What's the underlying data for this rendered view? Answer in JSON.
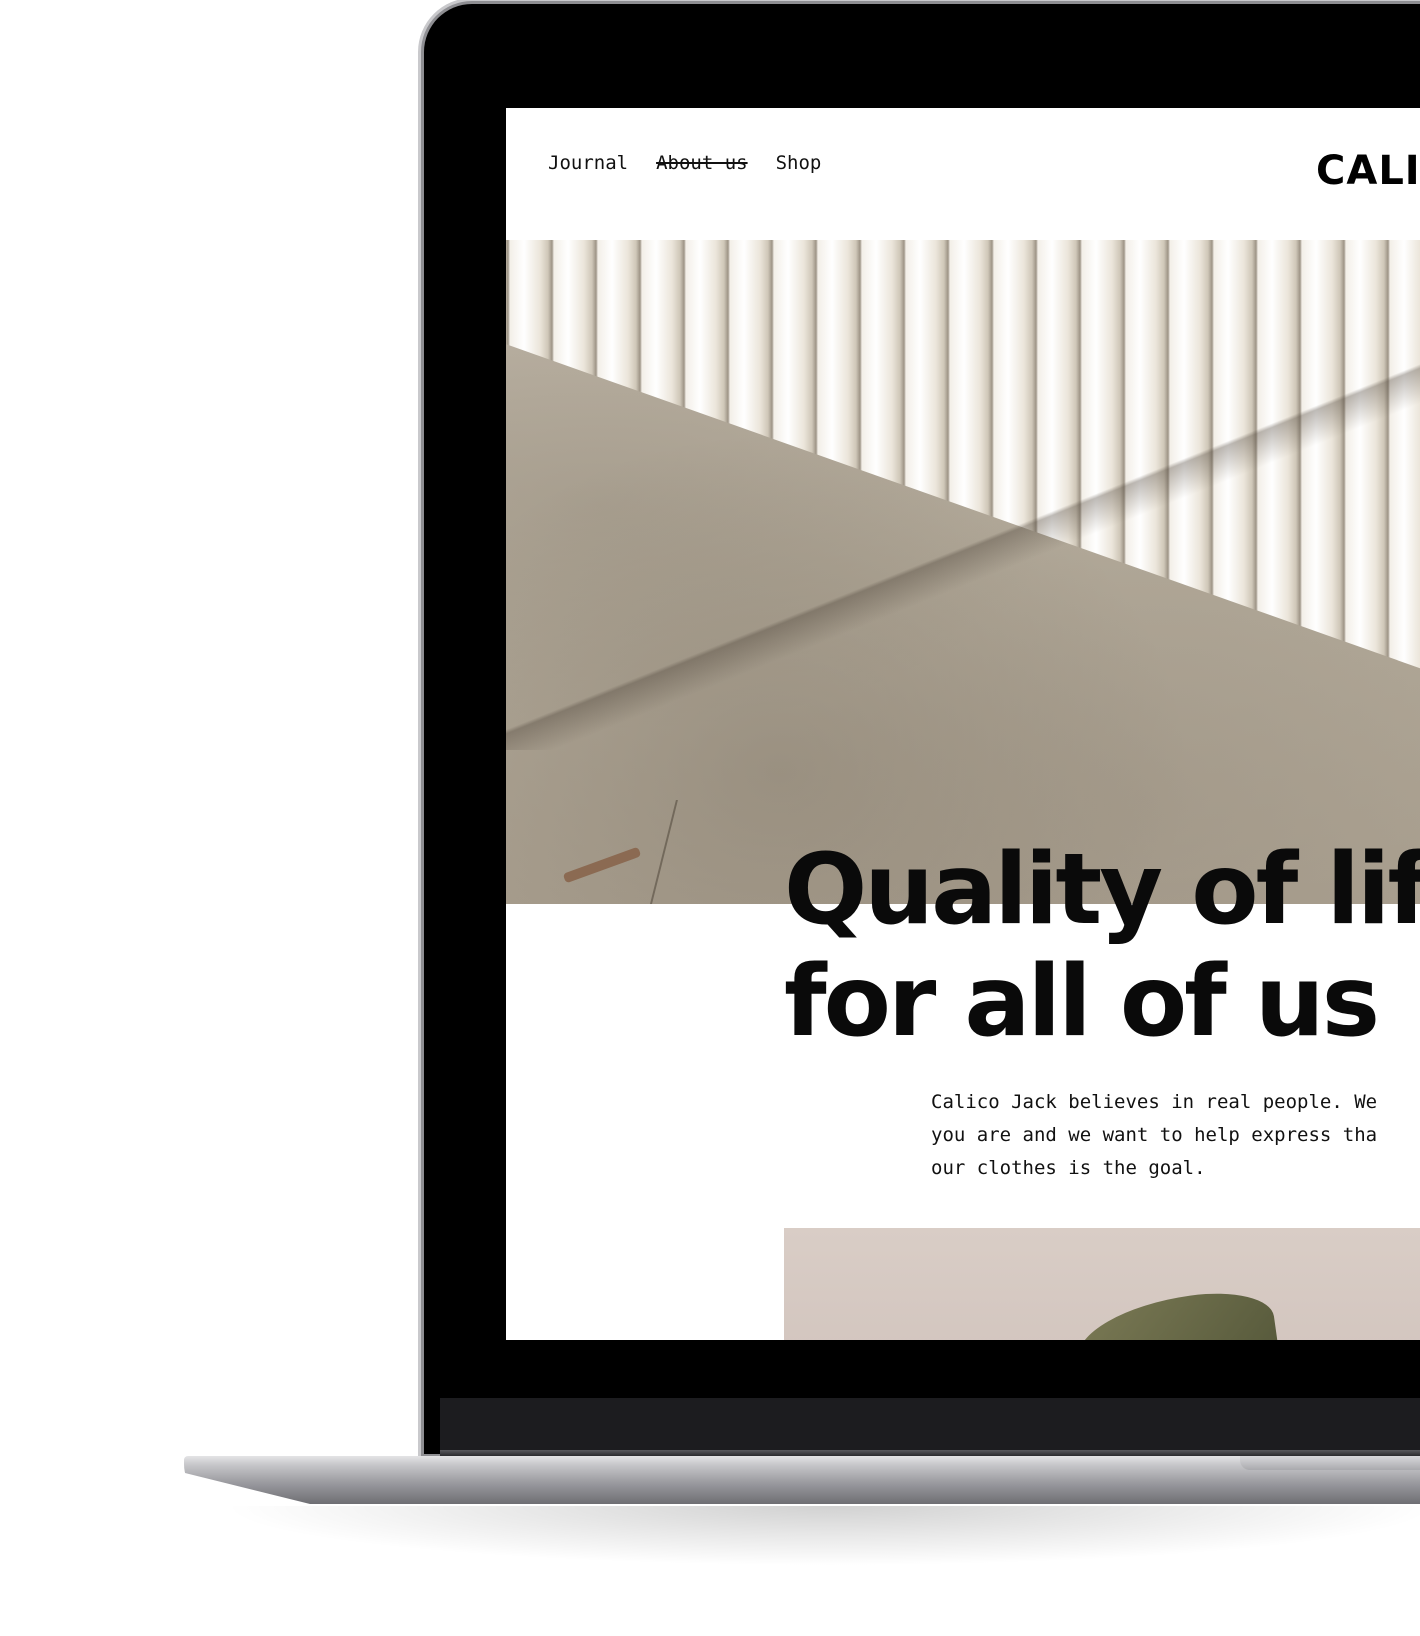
{
  "site": {
    "nav": [
      {
        "label": "Journal",
        "strikethrough": false
      },
      {
        "label": "About us",
        "strikethrough": true
      },
      {
        "label": "Shop",
        "strikethrough": false
      }
    ],
    "logo_text": "CALI"
  },
  "hero": {
    "headline_line1": "Quality of life",
    "headline_line2": "for all of us",
    "intro_lines": [
      "Calico Jack believes in real people. We",
      "you are and we want to help express tha",
      "our clothes is the goal."
    ]
  },
  "colors": {
    "text": "#111111",
    "background": "#ffffff",
    "bezel": "#000000"
  },
  "icons": {
    "hero_image": "white-fluted-columns-on-concrete",
    "second_image": "leaf-on-pink-background"
  }
}
